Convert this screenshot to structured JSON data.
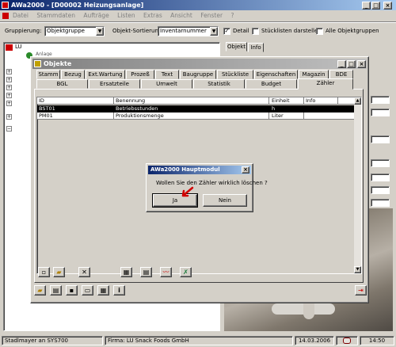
{
  "app": {
    "title": "AWa2000 - [D00002 Heizungsanlage]",
    "menu": [
      "Datei",
      "Stammdaten",
      "Aufträge",
      "Listen",
      "Extras",
      "Ansicht",
      "Fenster",
      "?"
    ]
  },
  "toolbar": {
    "grouping_label": "Gruppierung:",
    "grouping_value": "Objektgruppe",
    "sort_label": "Objekt-Sortierung:",
    "sort_value": "Inventarnummer",
    "detail_label": "Detail",
    "detail_checked": true,
    "parts_label": "Stücklisten darstellen",
    "parts_checked": false,
    "allgroups_label": "Alle Objektgruppen",
    "allgroups_checked": false
  },
  "tree": {
    "root_label": "LU",
    "partial_label": "Anlage"
  },
  "right_tabs": [
    "Objekt",
    "Info"
  ],
  "objekte": {
    "title": "Objekte",
    "tabs_row1": [
      "Stamm",
      "Bezug",
      "Ext.Wartung",
      "Prozeß",
      "Text",
      "Baugruppe",
      "Stückliste",
      "Eigenschaften",
      "Magazin",
      "BDE"
    ],
    "tabs_row2": [
      "BGL",
      "Ersatzteile",
      "Umwelt",
      "Statistik",
      "Budget",
      "Zähler"
    ],
    "active_tab": "Zähler",
    "table": {
      "columns": [
        "ID",
        "Benennung",
        "Einheit",
        "Info"
      ],
      "rows": [
        {
          "id": "BST01",
          "name": "Betriebsstunden",
          "unit": "h",
          "info": ""
        },
        {
          "id": "PM01",
          "name": "Produktionsmenge",
          "unit": "Liter",
          "info": ""
        }
      ]
    }
  },
  "dialog": {
    "title": "AWa2000 Hauptmodul",
    "message": "Wollen Sie den Zähler wirklich löschen ?",
    "yes": "Ja",
    "no": "Nein"
  },
  "statusbar": {
    "user": "Stadlmayer an SYS700",
    "company": "Firma: LU Snack Foods GmbH",
    "date": "14.03.2006",
    "time": "14:50"
  },
  "colors": {
    "title_active": "#0a246a",
    "selection": "#000080",
    "pointer": "#d00000"
  }
}
